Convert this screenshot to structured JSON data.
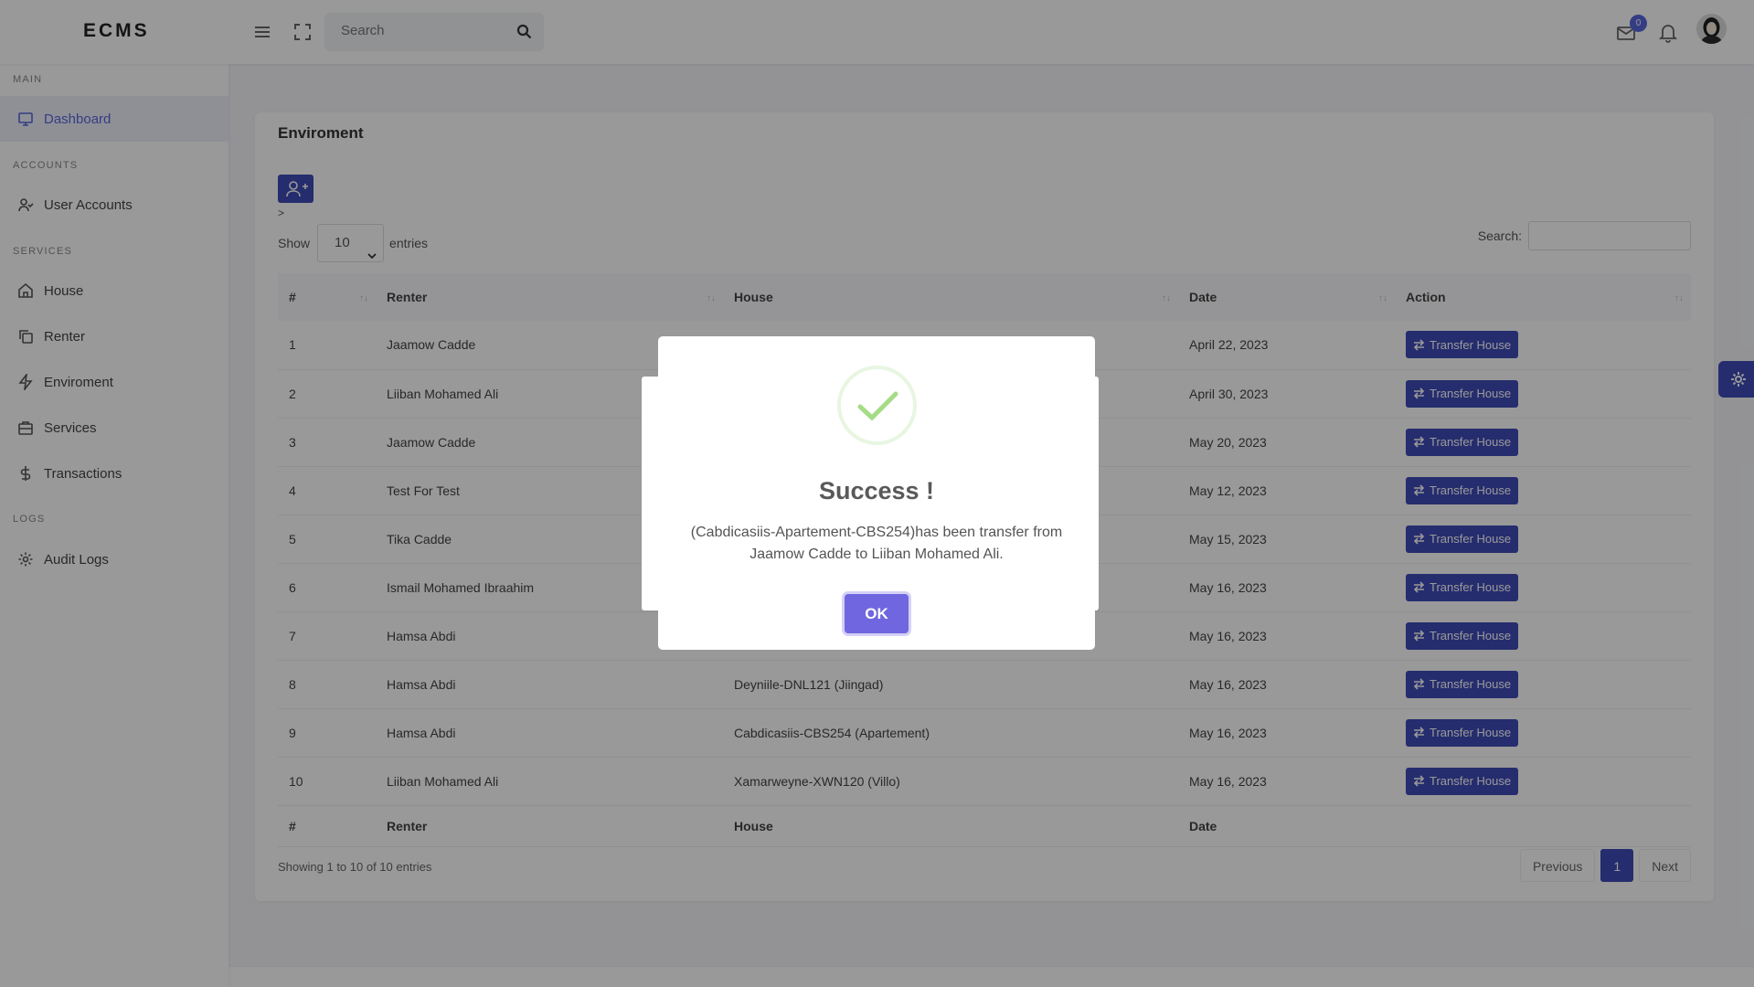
{
  "app": {
    "logo": "ECMS",
    "search_placeholder": "Search",
    "mail_badge": "0"
  },
  "sidebar": {
    "sections": [
      {
        "label": "MAIN"
      },
      {
        "label": "ACCOUNTS"
      },
      {
        "label": "SERVICES"
      },
      {
        "label": "LOGS"
      }
    ],
    "items": [
      {
        "label": "Dashboard",
        "icon": "monitor-icon"
      },
      {
        "label": "User Accounts",
        "icon": "user-icon"
      },
      {
        "label": "House",
        "icon": "home-icon"
      },
      {
        "label": "Renter",
        "icon": "copy-icon"
      },
      {
        "label": "Enviroment",
        "icon": "zap-icon"
      },
      {
        "label": "Services",
        "icon": "briefcase-icon"
      },
      {
        "label": "Transactions",
        "icon": "dollar-icon"
      },
      {
        "label": "Audit Logs",
        "icon": "gear-icon"
      }
    ]
  },
  "page": {
    "title": "Enviroment",
    "gt": ">",
    "show_label": "Show",
    "entries_value": "10",
    "entries_label": "entries",
    "search_label": "Search:"
  },
  "table": {
    "headers": [
      "#",
      "Renter",
      "House",
      "Date",
      "Action"
    ],
    "footer_headers": [
      "#",
      "Renter",
      "House",
      "Date"
    ],
    "action_label": "Transfer House",
    "rows": [
      {
        "num": "1",
        "renter": "Jaamow Cadde",
        "house": "",
        "date": "April 22, 2023"
      },
      {
        "num": "2",
        "renter": "Liiban Mohamed Ali",
        "house": "",
        "date": "April 30, 2023"
      },
      {
        "num": "3",
        "renter": "Jaamow Cadde",
        "house": "",
        "date": "May 20, 2023"
      },
      {
        "num": "4",
        "renter": "Test For Test",
        "house": "",
        "date": "May 12, 2023"
      },
      {
        "num": "5",
        "renter": "Tika Cadde",
        "house": "",
        "date": "May 15, 2023"
      },
      {
        "num": "6",
        "renter": "Ismail Mohamed Ibraahim",
        "house": "",
        "date": "May 16, 2023"
      },
      {
        "num": "7",
        "renter": "Hamsa Abdi",
        "house": "",
        "date": "May 16, 2023"
      },
      {
        "num": "8",
        "renter": "Hamsa Abdi",
        "house": "Deyniile-DNL121 (Jiingad)",
        "date": "May 16, 2023"
      },
      {
        "num": "9",
        "renter": "Hamsa Abdi",
        "house": "Cabdicasiis-CBS254 (Apartement)",
        "date": "May 16, 2023"
      },
      {
        "num": "10",
        "renter": "Liiban Mohamed Ali",
        "house": "Xamarweyne-XWN120 (Villo)",
        "date": "May 16, 2023"
      }
    ]
  },
  "pagination": {
    "info": "Showing 1 to 10 of 10 entries",
    "previous": "Previous",
    "current": "1",
    "next": "Next"
  },
  "dialog": {
    "title": "Success !",
    "message": "(Cabdicasiis-Apartement-CBS254)has been transfer from Jaamow Cadde to Liiban Mohamed Ali.",
    "ok_label": "OK"
  },
  "colors": {
    "accent": "#3f4bb8",
    "confirm": "#7066e0",
    "success": "#a5dc86"
  }
}
